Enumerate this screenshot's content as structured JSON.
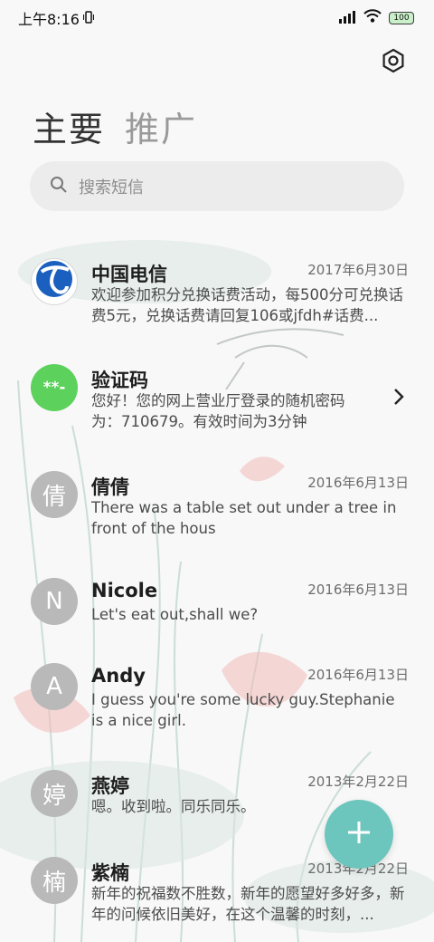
{
  "status_bar": {
    "time": "上午8:16",
    "battery": "100"
  },
  "tabs": {
    "main": "主要",
    "promo": "推广"
  },
  "search": {
    "placeholder": "搜索短信"
  },
  "conversations": [
    {
      "name": "中国电信",
      "date": "2017年6月30日",
      "preview": "欢迎参加积分兑换话费活动，每500分可兑换话费5元，兑换话费请回复106或jfdh#话费...",
      "avatar": "telecom-logo"
    },
    {
      "name": "验证码",
      "date": "",
      "preview": "您好！您的网上营业厅登录的随机密码为：710679。有效时间为3分钟",
      "avatar_text": "**-"
    },
    {
      "name": "倩倩",
      "date": "2016年6月13日",
      "preview": "There was a table set out under a tree in front of the hous",
      "avatar_text": "倩"
    },
    {
      "name": "Nicole",
      "date": "2016年6月13日",
      "preview": "Let's eat out,shall we?",
      "avatar_text": "N"
    },
    {
      "name": "Andy",
      "date": "2016年6月13日",
      "preview": "I guess you're some lucky guy.Stephanie is a nice girl.",
      "avatar_text": "A"
    },
    {
      "name": "燕婷",
      "date": "2013年2月22日",
      "preview": "嗯。收到啦。同乐同乐。",
      "avatar_text": "婷"
    },
    {
      "name": "紫楠",
      "date": "2013年2月22日",
      "preview": "新年的祝福数不胜数，新年的愿望好多好多，新年的问候依旧美好，在这个温馨的时刻，...",
      "avatar_text": "楠"
    }
  ],
  "colors": {
    "fab": "#6cc6bd",
    "verify_avatar": "#5cd15c",
    "search_bg": "#ececec"
  }
}
